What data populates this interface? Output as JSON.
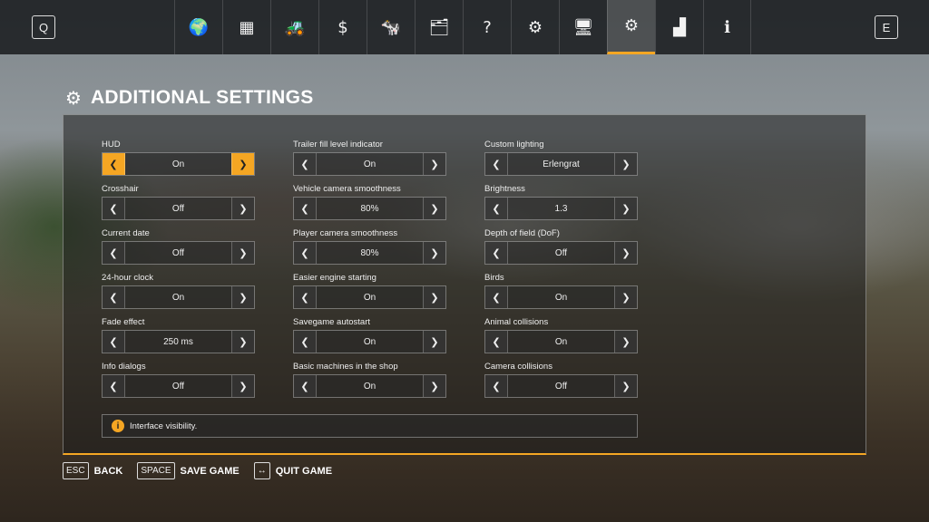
{
  "topbar": {
    "left_key": "Q",
    "right_key": "E",
    "tabs": [
      {
        "icon": "globe-icon",
        "glyph": "🌍"
      },
      {
        "icon": "statistics-icon",
        "glyph": "▦"
      },
      {
        "icon": "tractor-icon",
        "glyph": "🚜"
      },
      {
        "icon": "finances-icon",
        "glyph": "$"
      },
      {
        "icon": "animals-icon",
        "glyph": "🐄"
      },
      {
        "icon": "contracts-icon",
        "glyph": "🗂"
      },
      {
        "icon": "help-icon",
        "glyph": "?"
      },
      {
        "icon": "vehicles-icon",
        "glyph": "⚙"
      },
      {
        "icon": "monitor-icon",
        "glyph": "🖥"
      },
      {
        "icon": "settings-icon",
        "glyph": "⚙",
        "active": true
      },
      {
        "icon": "controls-icon",
        "glyph": "▟"
      },
      {
        "icon": "info-icon",
        "glyph": "ℹ"
      }
    ]
  },
  "title": "ADDITIONAL SETTINGS",
  "columns": [
    [
      {
        "label": "HUD",
        "value": "On",
        "highlighted": true
      },
      {
        "label": "Crosshair",
        "value": "Off"
      },
      {
        "label": "Current date",
        "value": "Off"
      },
      {
        "label": "24-hour clock",
        "value": "On"
      },
      {
        "label": "Fade effect",
        "value": "250 ms"
      },
      {
        "label": "Info dialogs",
        "value": "Off"
      }
    ],
    [
      {
        "label": "Trailer fill level indicator",
        "value": "On"
      },
      {
        "label": "Vehicle camera smoothness",
        "value": "80%"
      },
      {
        "label": "Player camera smoothness",
        "value": "80%"
      },
      {
        "label": "Easier engine starting",
        "value": "On"
      },
      {
        "label": "Savegame autostart",
        "value": "On"
      },
      {
        "label": "Basic machines in the shop",
        "value": "On"
      }
    ],
    [
      {
        "label": "Custom lighting",
        "value": "Erlengrat"
      },
      {
        "label": "Brightness",
        "value": "1.3"
      },
      {
        "label": "Depth of field (DoF)",
        "value": "Off"
      },
      {
        "label": "Birds",
        "value": "On"
      },
      {
        "label": "Animal collisions",
        "value": "On"
      },
      {
        "label": "Camera collisions",
        "value": "Off"
      }
    ]
  ],
  "info": {
    "icon": "i",
    "text": "Interface visibility."
  },
  "footer": [
    {
      "key": "ESC",
      "label": "BACK"
    },
    {
      "key": "SPACE",
      "label": "SAVE GAME"
    },
    {
      "key": "↔",
      "label": "QUIT GAME"
    }
  ],
  "colors": {
    "accent": "#f5a623"
  }
}
